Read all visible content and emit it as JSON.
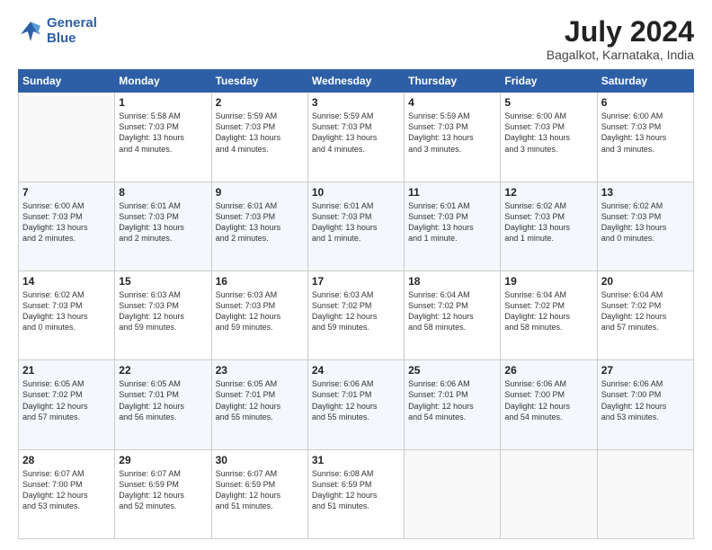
{
  "logo": {
    "line1": "General",
    "line2": "Blue"
  },
  "title": "July 2024",
  "location": "Bagalkot, Karnataka, India",
  "days_header": [
    "Sunday",
    "Monday",
    "Tuesday",
    "Wednesday",
    "Thursday",
    "Friday",
    "Saturday"
  ],
  "weeks": [
    [
      {
        "day": "",
        "info": ""
      },
      {
        "day": "1",
        "info": "Sunrise: 5:58 AM\nSunset: 7:03 PM\nDaylight: 13 hours\nand 4 minutes."
      },
      {
        "day": "2",
        "info": "Sunrise: 5:59 AM\nSunset: 7:03 PM\nDaylight: 13 hours\nand 4 minutes."
      },
      {
        "day": "3",
        "info": "Sunrise: 5:59 AM\nSunset: 7:03 PM\nDaylight: 13 hours\nand 4 minutes."
      },
      {
        "day": "4",
        "info": "Sunrise: 5:59 AM\nSunset: 7:03 PM\nDaylight: 13 hours\nand 3 minutes."
      },
      {
        "day": "5",
        "info": "Sunrise: 6:00 AM\nSunset: 7:03 PM\nDaylight: 13 hours\nand 3 minutes."
      },
      {
        "day": "6",
        "info": "Sunrise: 6:00 AM\nSunset: 7:03 PM\nDaylight: 13 hours\nand 3 minutes."
      }
    ],
    [
      {
        "day": "7",
        "info": "Sunrise: 6:00 AM\nSunset: 7:03 PM\nDaylight: 13 hours\nand 2 minutes."
      },
      {
        "day": "8",
        "info": "Sunrise: 6:01 AM\nSunset: 7:03 PM\nDaylight: 13 hours\nand 2 minutes."
      },
      {
        "day": "9",
        "info": "Sunrise: 6:01 AM\nSunset: 7:03 PM\nDaylight: 13 hours\nand 2 minutes."
      },
      {
        "day": "10",
        "info": "Sunrise: 6:01 AM\nSunset: 7:03 PM\nDaylight: 13 hours\nand 1 minute."
      },
      {
        "day": "11",
        "info": "Sunrise: 6:01 AM\nSunset: 7:03 PM\nDaylight: 13 hours\nand 1 minute."
      },
      {
        "day": "12",
        "info": "Sunrise: 6:02 AM\nSunset: 7:03 PM\nDaylight: 13 hours\nand 1 minute."
      },
      {
        "day": "13",
        "info": "Sunrise: 6:02 AM\nSunset: 7:03 PM\nDaylight: 13 hours\nand 0 minutes."
      }
    ],
    [
      {
        "day": "14",
        "info": "Sunrise: 6:02 AM\nSunset: 7:03 PM\nDaylight: 13 hours\nand 0 minutes."
      },
      {
        "day": "15",
        "info": "Sunrise: 6:03 AM\nSunset: 7:03 PM\nDaylight: 12 hours\nand 59 minutes."
      },
      {
        "day": "16",
        "info": "Sunrise: 6:03 AM\nSunset: 7:03 PM\nDaylight: 12 hours\nand 59 minutes."
      },
      {
        "day": "17",
        "info": "Sunrise: 6:03 AM\nSunset: 7:02 PM\nDaylight: 12 hours\nand 59 minutes."
      },
      {
        "day": "18",
        "info": "Sunrise: 6:04 AM\nSunset: 7:02 PM\nDaylight: 12 hours\nand 58 minutes."
      },
      {
        "day": "19",
        "info": "Sunrise: 6:04 AM\nSunset: 7:02 PM\nDaylight: 12 hours\nand 58 minutes."
      },
      {
        "day": "20",
        "info": "Sunrise: 6:04 AM\nSunset: 7:02 PM\nDaylight: 12 hours\nand 57 minutes."
      }
    ],
    [
      {
        "day": "21",
        "info": "Sunrise: 6:05 AM\nSunset: 7:02 PM\nDaylight: 12 hours\nand 57 minutes."
      },
      {
        "day": "22",
        "info": "Sunrise: 6:05 AM\nSunset: 7:01 PM\nDaylight: 12 hours\nand 56 minutes."
      },
      {
        "day": "23",
        "info": "Sunrise: 6:05 AM\nSunset: 7:01 PM\nDaylight: 12 hours\nand 55 minutes."
      },
      {
        "day": "24",
        "info": "Sunrise: 6:06 AM\nSunset: 7:01 PM\nDaylight: 12 hours\nand 55 minutes."
      },
      {
        "day": "25",
        "info": "Sunrise: 6:06 AM\nSunset: 7:01 PM\nDaylight: 12 hours\nand 54 minutes."
      },
      {
        "day": "26",
        "info": "Sunrise: 6:06 AM\nSunset: 7:00 PM\nDaylight: 12 hours\nand 54 minutes."
      },
      {
        "day": "27",
        "info": "Sunrise: 6:06 AM\nSunset: 7:00 PM\nDaylight: 12 hours\nand 53 minutes."
      }
    ],
    [
      {
        "day": "28",
        "info": "Sunrise: 6:07 AM\nSunset: 7:00 PM\nDaylight: 12 hours\nand 53 minutes."
      },
      {
        "day": "29",
        "info": "Sunrise: 6:07 AM\nSunset: 6:59 PM\nDaylight: 12 hours\nand 52 minutes."
      },
      {
        "day": "30",
        "info": "Sunrise: 6:07 AM\nSunset: 6:59 PM\nDaylight: 12 hours\nand 51 minutes."
      },
      {
        "day": "31",
        "info": "Sunrise: 6:08 AM\nSunset: 6:59 PM\nDaylight: 12 hours\nand 51 minutes."
      },
      {
        "day": "",
        "info": ""
      },
      {
        "day": "",
        "info": ""
      },
      {
        "day": "",
        "info": ""
      }
    ]
  ]
}
